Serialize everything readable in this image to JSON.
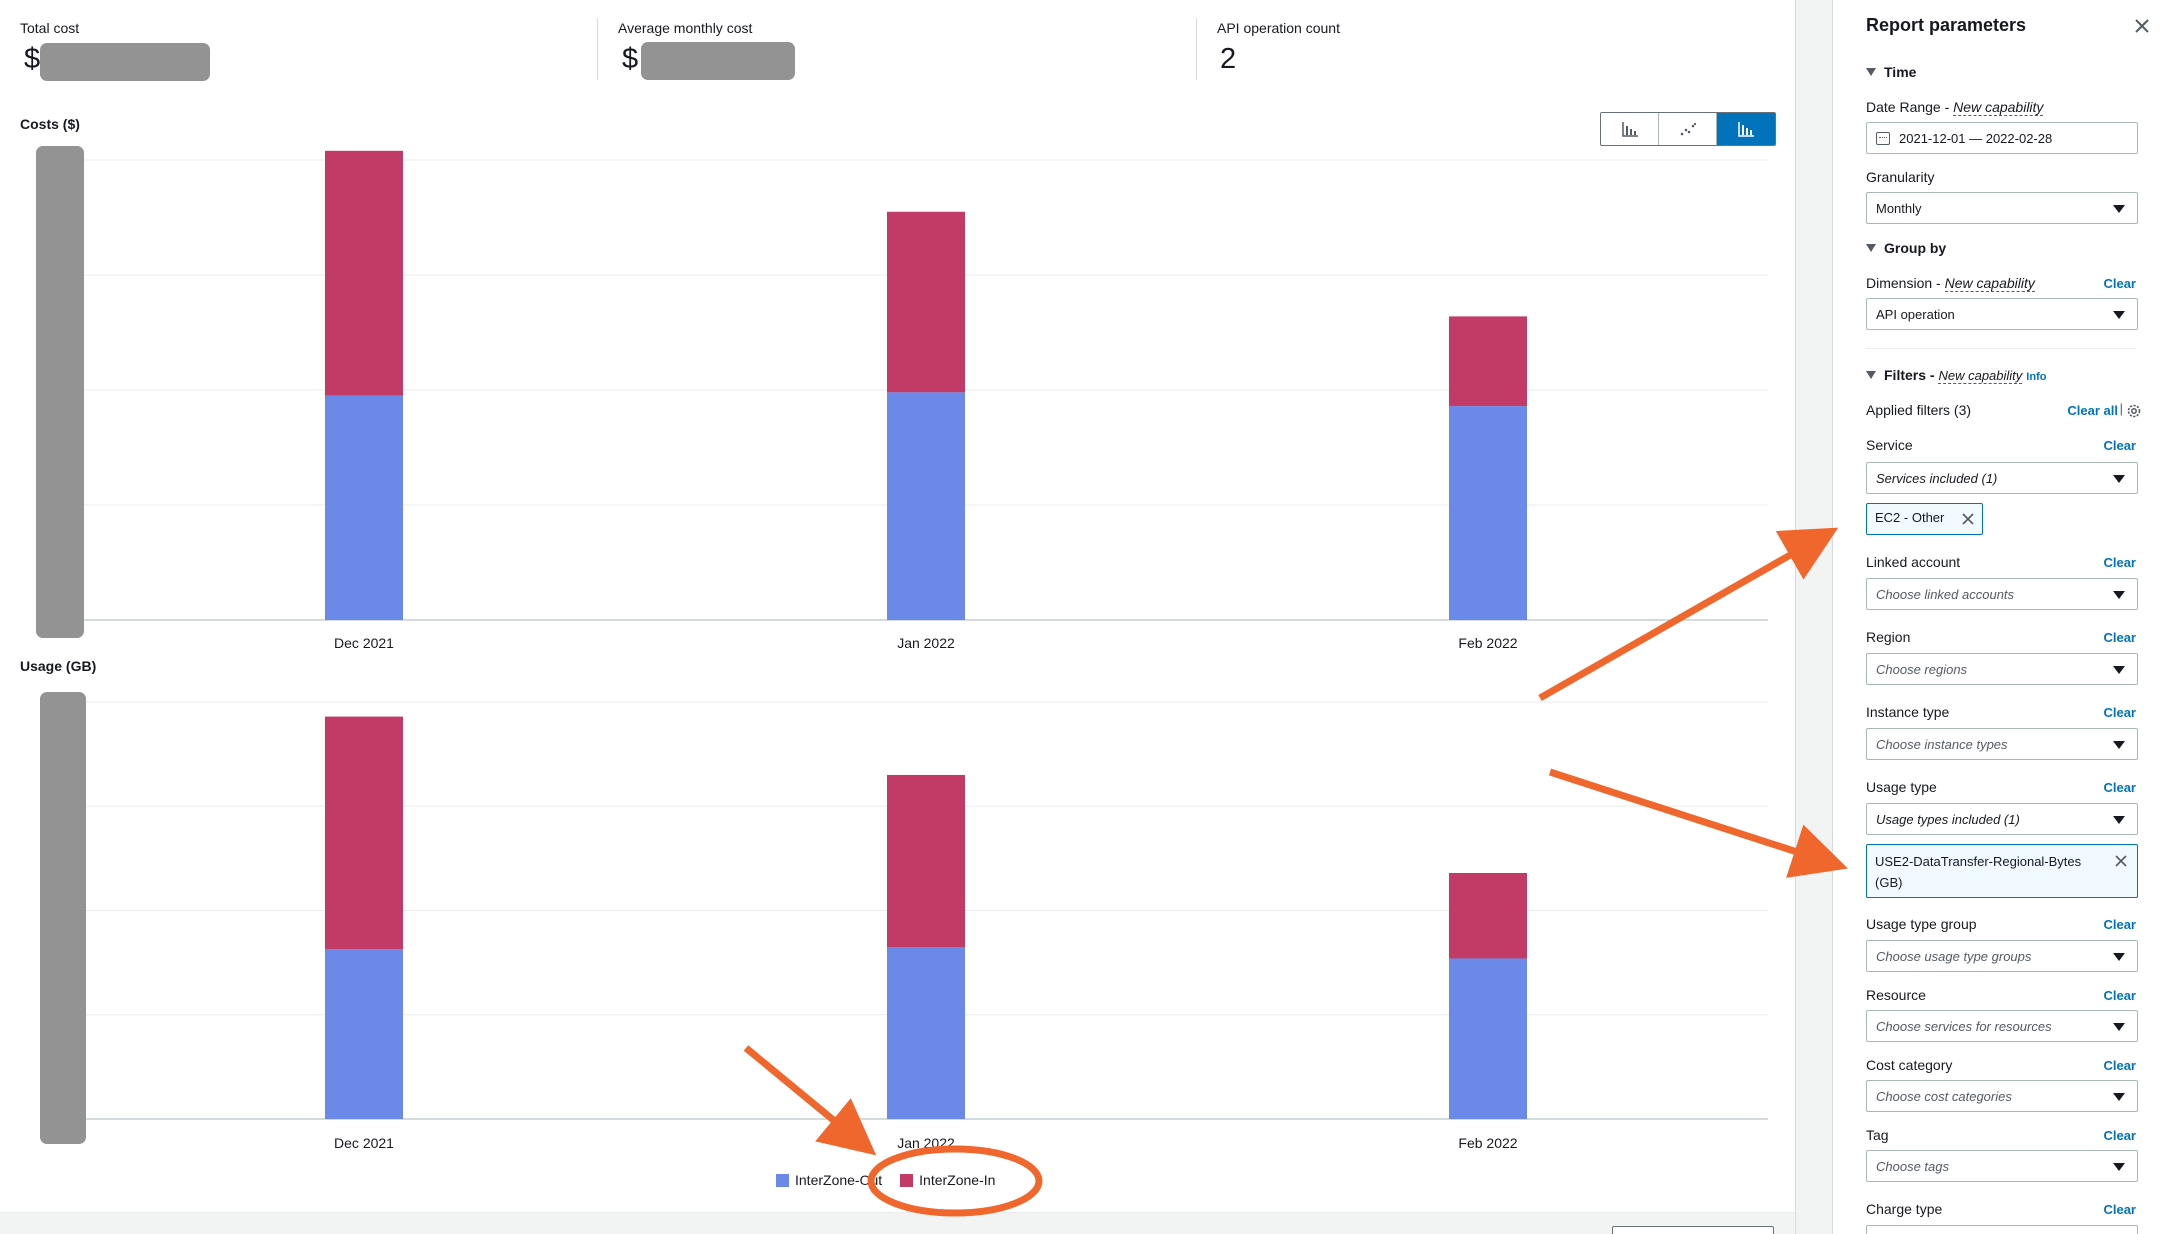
{
  "summary": {
    "total_cost_label": "Total cost",
    "total_cost_prefix": "$",
    "avg_cost_label": "Average monthly cost",
    "avg_cost_prefix": "$",
    "api_count_label": "API operation count",
    "api_count_value": "2"
  },
  "view_toggle": {
    "icons": [
      "bar-chart-icon",
      "line-chart-icon",
      "stacked-bar-chart-icon"
    ],
    "active_index": 2
  },
  "colors": {
    "out": "#6a89e8",
    "in": "#c23a66",
    "accent": "#0073bb",
    "annotation": "#f0672e"
  },
  "chart_data": [
    {
      "type": "bar",
      "stacked": true,
      "title": "Costs ($)",
      "categories": [
        "Dec 2021",
        "Jan 2022",
        "Feb 2022"
      ],
      "series": [
        {
          "name": "InterZone-Out",
          "values": [
            1.95,
            1.98,
            1.86
          ]
        },
        {
          "name": "InterZone-In",
          "values": [
            2.13,
            1.57,
            0.78
          ]
        }
      ],
      "ylim": [
        0,
        4
      ],
      "grid": true
    },
    {
      "type": "bar",
      "stacked": true,
      "title": "Usage (GB)",
      "categories": [
        "Dec 2021",
        "Jan 2022",
        "Feb 2022"
      ],
      "series": [
        {
          "name": "InterZone-Out",
          "values": [
            1.63,
            1.65,
            1.54
          ]
        },
        {
          "name": "InterZone-In",
          "values": [
            2.23,
            1.65,
            0.82
          ]
        }
      ],
      "ylim": [
        0,
        4
      ],
      "grid": true
    }
  ],
  "legend": [
    {
      "label": "InterZone-Out",
      "color": "#6a89e8"
    },
    {
      "label": "InterZone-In",
      "color": "#c23a66"
    }
  ],
  "panel": {
    "title": "Report parameters",
    "time_section": "Time",
    "date_range_label": "Date Range - ",
    "new_capability": "New capability",
    "date_range_value": "2021-12-01 — 2022-02-28",
    "granularity_label": "Granularity",
    "granularity_value": "Monthly",
    "group_by_section": "Group by",
    "dimension_label": "Dimension - ",
    "dimension_value": "API operation",
    "filters_section": "Filters - ",
    "info": "Info",
    "applied_filters": "Applied filters (3)",
    "clear_all": "Clear all",
    "clear": "Clear",
    "service_label": "Service",
    "service_value": "Services included (1)",
    "service_token": "EC2 - Other",
    "linked_account_label": "Linked account",
    "linked_account_placeholder": "Choose linked accounts",
    "region_label": "Region",
    "region_placeholder": "Choose regions",
    "instance_type_label": "Instance type",
    "instance_type_placeholder": "Choose instance types",
    "usage_type_label": "Usage type",
    "usage_type_value": "Usage types included (1)",
    "usage_type_token": "USE2-DataTransfer-Regional-Bytes (GB)",
    "usage_type_group_label": "Usage type group",
    "usage_type_group_placeholder": "Choose usage type groups",
    "resource_label": "Resource",
    "resource_placeholder": "Choose services for resources",
    "cost_category_label": "Cost category",
    "cost_category_placeholder": "Choose cost categories",
    "tag_label": "Tag",
    "tag_placeholder": "Choose tags",
    "charge_type_label": "Charge type"
  }
}
